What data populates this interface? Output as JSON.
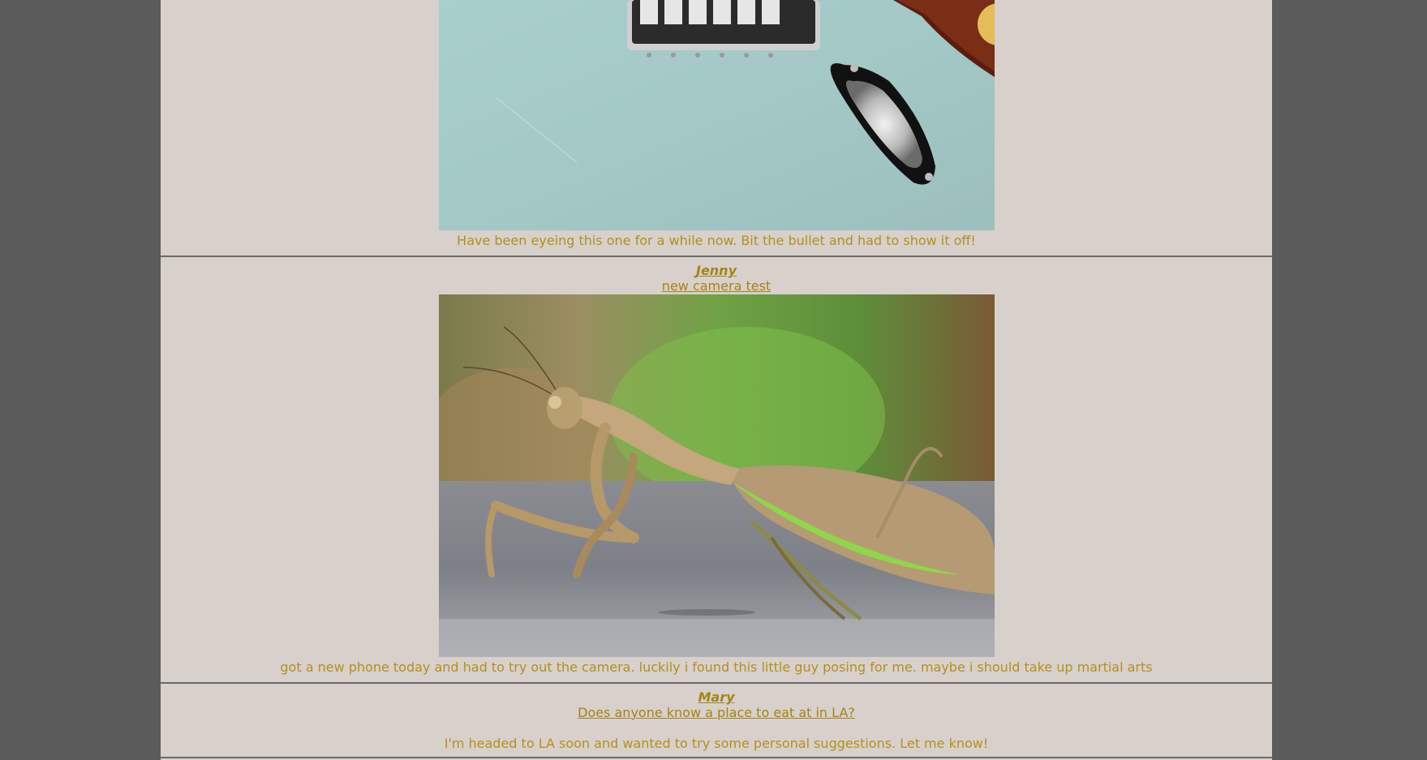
{
  "colors": {
    "page_bg": "#5b5b5b",
    "feed_bg": "#d8d0ca",
    "accent": "#b3901f",
    "separator": "#6a6a6a"
  },
  "posts": [
    {
      "author": "",
      "title": "",
      "image": "guitar-photo",
      "caption": "Have been eyeing this one for a while now. Bit the bullet and had to show it off!"
    },
    {
      "author": "Jenny",
      "title": "new camera test",
      "image": "praying-mantis-photo",
      "caption": "got a new phone today and had to try out the camera. luckily i found this little guy posing for me. maybe i should take up martial arts"
    },
    {
      "author": "Mary",
      "title": "Does anyone know a place to eat at in LA?",
      "image": "",
      "caption": "I'm headed to LA soon and wanted to try some personal suggestions. Let me know!"
    }
  ]
}
